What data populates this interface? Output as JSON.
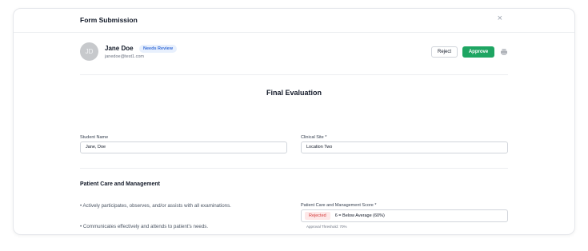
{
  "header": {
    "title": "Form Submission",
    "close_symbol": "×"
  },
  "user": {
    "initials": "JD",
    "name": "Jane Doe",
    "status": "Needs Review",
    "email": "janedoe@test1.com"
  },
  "actions": {
    "reject": "Reject",
    "approve": "Approve"
  },
  "icons": {
    "close": "close-icon",
    "print": "printer-icon"
  },
  "colors": {
    "approve_bg": "#1ea562",
    "badge_bg": "#e8f0fd",
    "badge_text": "#3b6fd8",
    "rejected_bg": "#fde8e8",
    "rejected_text": "#d43b3b"
  },
  "form": {
    "title": "Final Evaluation",
    "student_name": {
      "label": "Student Name",
      "value": "Jane, Doe"
    },
    "clinical_site": {
      "label": "Clinical Site *",
      "value": "Location Two"
    },
    "section": {
      "title": "Patient Care and Management",
      "bullets": [
        "• Actively participates, observes, and/or assists with all examinations.",
        "• Communicates effectively and attends to patient's needs."
      ],
      "score": {
        "label": "Patient Care and Management Score *",
        "status": "Rejected",
        "value": "6 = Below Average (60%)",
        "threshold": "Approval Threshold: 70%"
      }
    }
  }
}
